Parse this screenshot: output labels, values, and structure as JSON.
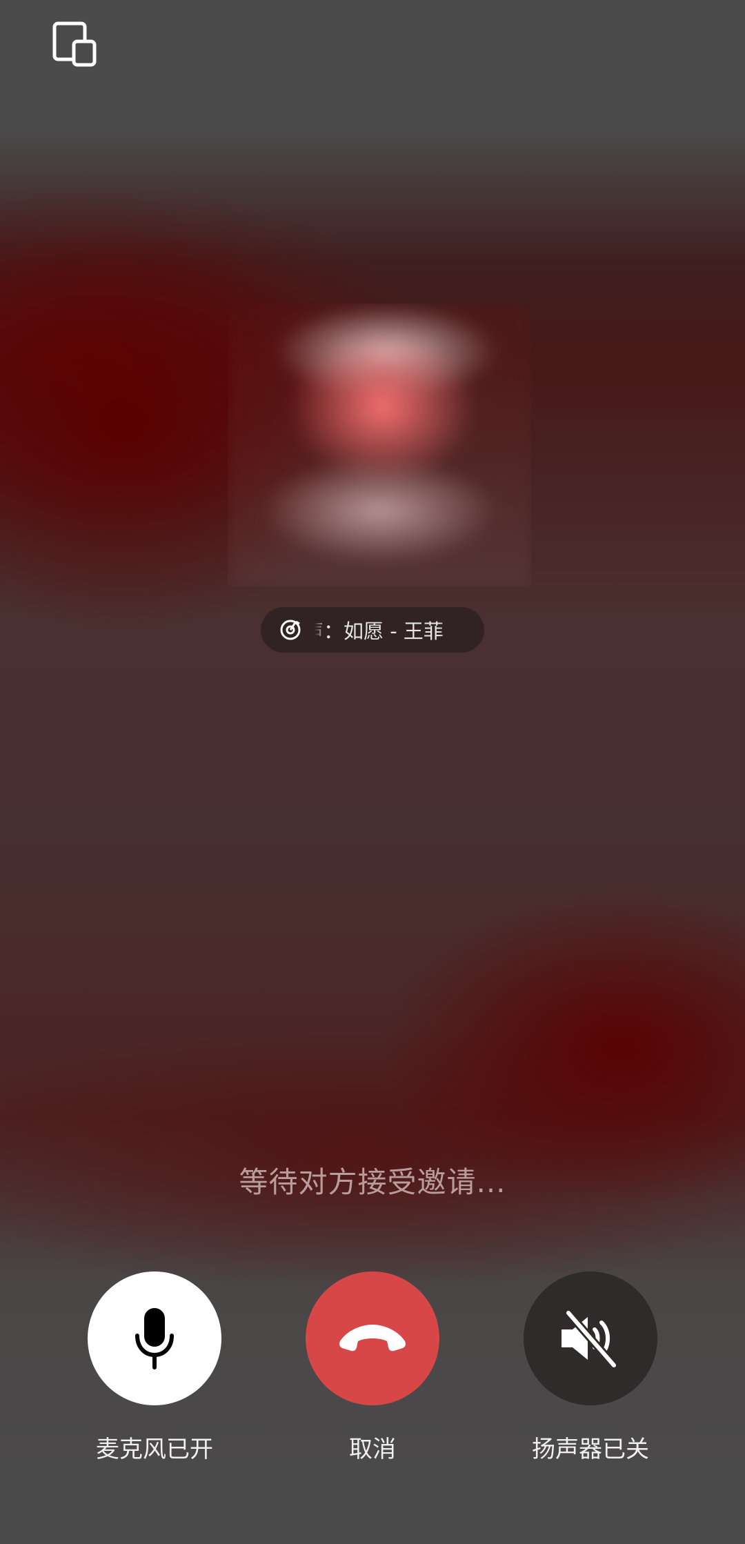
{
  "call": {
    "background_music": "声：如愿 - 王菲",
    "status_text": "等待对方接受邀请..."
  },
  "controls": {
    "microphone_label": "麦克风已开",
    "cancel_label": "取消",
    "speaker_label": "扬声器已关"
  },
  "icons": {
    "top_left": "minimize-window-icon",
    "music": "music-disc-icon",
    "microphone": "microphone-icon",
    "hangup": "phone-hangup-icon",
    "speaker": "speaker-muted-icon"
  },
  "colors": {
    "cancel_button": "#d84747",
    "microphone_button": "#ffffff",
    "speaker_button": "#2f2b2b",
    "accent_red": "#5a0000"
  }
}
